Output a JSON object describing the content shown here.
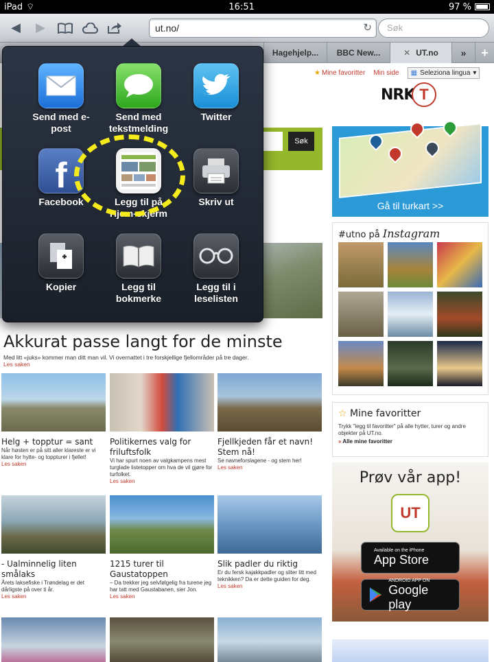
{
  "status": {
    "device": "iPad",
    "time": "16:51",
    "battery": "97 %"
  },
  "toolbar": {
    "url": "ut.no/",
    "search_placeholder": "Søk"
  },
  "tabs": [
    "Hagehjelp...",
    "BBC New...",
    "UT.no"
  ],
  "share_menu": {
    "items": [
      {
        "label": "Send med e-post",
        "icon": "mail-icon"
      },
      {
        "label": "Send med tekstmelding",
        "icon": "message-icon"
      },
      {
        "label": "Twitter",
        "icon": "twitter-icon"
      },
      {
        "label": "Facebook",
        "icon": "facebook-icon"
      },
      {
        "label": "Legg til på Hjem-skjerm",
        "icon": "home-screen-icon"
      },
      {
        "label": "Skriv ut",
        "icon": "print-icon"
      },
      {
        "label": "Kopier",
        "icon": "copy-icon"
      },
      {
        "label": "Legg til bokmerke",
        "icon": "bookmark-icon"
      },
      {
        "label": "Legg til i leselisten",
        "icon": "reading-list-icon"
      }
    ]
  },
  "site": {
    "topnav": {
      "favorites": "Mine favoritter",
      "my_page": "Min side",
      "language": "Seleziona lingua"
    },
    "search_button": "Søk",
    "headline": "Akkurat passe langt for de minste",
    "lede": "Med litt «juks» kommer man ditt man vil. Vi overnattet i tre forskjellige fjellområder på tre dager.",
    "read_more": "Les saken",
    "articles": [
      {
        "title": "Helg + topptur = sant",
        "desc": "Når høsten er på sitt aller klareste er vi klare for hytte- og toppturer i fjellet!"
      },
      {
        "title": "Politikernes valg for friluftsfolk",
        "desc": "Vi har spurt noen av valgkampens mest turglade listetopper om hva de vil gjøre for turfolket."
      },
      {
        "title": "Fjellkjeden får et navn! Stem nå!",
        "desc": "Se navneforslagene - og stem her!"
      },
      {
        "title": "- Ualminnelig liten smålaks",
        "desc": "Årets laksefiske i Trøndelag er det dårligste på over ti år."
      },
      {
        "title": "1215 turer til Gaustatoppen",
        "desc": "– Da trekker jeg selvfølgelig fra turene jeg har tatt med Gaustabanen, sier Jon."
      },
      {
        "title": "Slik padler du riktig",
        "desc": "Er du fersk kajakkpadler og sliter litt med teknikken? Da er dette guiden for deg."
      }
    ],
    "map_link": "Gå til turkart >>",
    "instagram": {
      "prefix": "#utno på",
      "script": "Instagram"
    },
    "favorites_box": {
      "title": "Mine favoritter",
      "text": "Trykk \"legg til favoritter\" på alle hytter, turer og andre objekter på UT.no.",
      "link": "Alle mine favoritter"
    },
    "app": {
      "title": "Prøv vår app!",
      "icon_text": "UT",
      "appstore_small": "Available on the iPhone",
      "appstore_big": "App Store",
      "play_small": "ANDROID APP ON",
      "play_big": "Google play"
    },
    "logos": {
      "nrk": "NRK",
      "dnt": "T"
    }
  }
}
